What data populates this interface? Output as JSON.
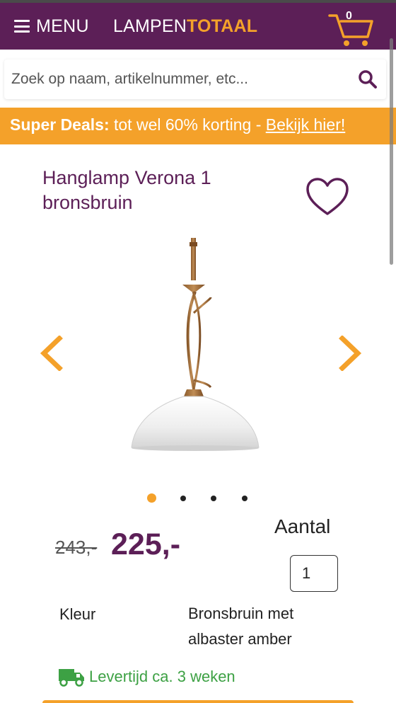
{
  "header": {
    "menu_label": "MENU",
    "logo_part1": "LAMPEN",
    "logo_part2": "TOTAAL",
    "cart_count": "0"
  },
  "search": {
    "placeholder": "Zoek op naam, artikelnummer, etc..."
  },
  "banner": {
    "bold": "Super Deals:",
    "text": " tot wel 60% korting - ",
    "link": "Bekijk hier!"
  },
  "product": {
    "title": "Hanglamp Verona 1 bronsbruin",
    "old_price": "243,-",
    "price": "225,-",
    "quantity_label": "Aantal",
    "quantity_value": "1",
    "color_label": "Kleur",
    "color_value": "Bronsbruin met albaster amber",
    "delivery": "Levertijd ca. 3 weken"
  },
  "gallery": {
    "active_index": 0,
    "image_count": 4
  },
  "icons": {
    "menu": "hamburger-icon",
    "cart": "cart-icon",
    "search": "search-icon",
    "favorite": "heart-icon",
    "prev": "chevron-left-icon",
    "next": "chevron-right-icon",
    "delivery": "truck-icon"
  },
  "colors": {
    "brand_purple": "#5c1f57",
    "brand_orange": "#f4a12a",
    "delivery_green": "#3da144"
  }
}
